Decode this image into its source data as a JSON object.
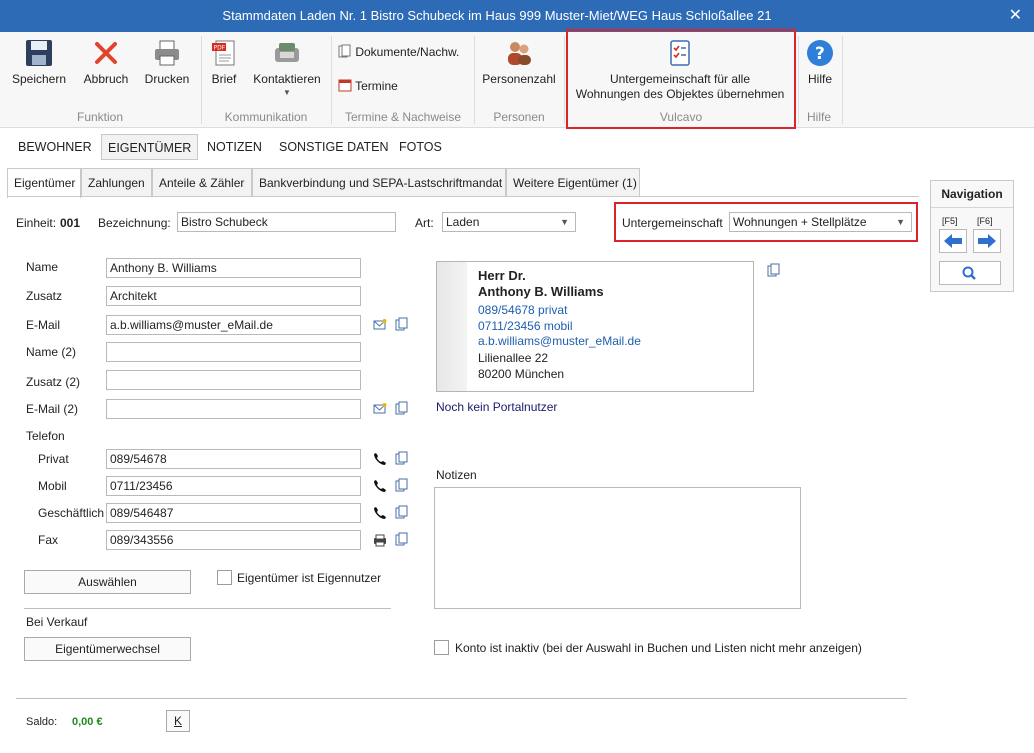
{
  "window": {
    "title": "Stammdaten Laden Nr. 1 Bistro Schubeck im Haus 999  Muster-Miet/WEG Haus Schloßallee 21",
    "close_glyph": "✕"
  },
  "ribbon": {
    "groups": {
      "funktion": "Funktion",
      "kommunikation": "Kommunikation",
      "termine": "Termine & Nachweise",
      "personen": "Personen",
      "vulcavo": "Vulcavo",
      "hilfe": "Hilfe"
    },
    "buttons": {
      "speichern": "Speichern",
      "abbruch": "Abbruch",
      "drucken": "Drucken",
      "brief": "Brief",
      "kontaktieren": "Kontaktieren",
      "dokumente": "Dokumente/Nachw.",
      "termine": "Termine",
      "personenzahl": "Personenzahl",
      "untergemeinschaft_line1": "Untergemeinschaft für alle",
      "untergemeinschaft_line2": "Wohnungen des Objektes übernehmen",
      "hilfe": "Hilfe"
    },
    "icons": {
      "save": "save-icon",
      "cancel": "cancel-icon",
      "print": "printer-icon",
      "pdf": "pdf-letter-icon",
      "contact": "fax-phone-icon",
      "docs": "documents-icon",
      "calendar": "calendar-icon",
      "people": "people-icon",
      "checklist": "checklist-icon",
      "help": "help-icon"
    },
    "accent_color": "#2e6bb7",
    "highlight_color": "#d9252a"
  },
  "section_tabs": [
    "BEWOHNER",
    "EIGENTÜMER",
    "NOTIZEN",
    "SONSTIGE DATEN",
    "FOTOS"
  ],
  "sub_tabs": [
    "Eigentümer",
    "Zahlungen",
    "Anteile & Zähler",
    "Bankverbindung und SEPA-Lastschriftmandat",
    "Weitere Eigentümer (1)"
  ],
  "header_row": {
    "einheit_label": "Einheit:",
    "einheit_value": "001",
    "bezeichnung_label": "Bezeichnung:",
    "bezeichnung_value": "Bistro Schubeck",
    "art_label": "Art:",
    "art_value": "Laden",
    "untergemeinschaft_label": "Untergemeinschaft",
    "untergemeinschaft_value": "Wohnungen + Stellplätze"
  },
  "form": {
    "name_label": "Name",
    "name_value": "Anthony B. Williams",
    "zusatz_label": "Zusatz",
    "zusatz_value": "Architekt",
    "email_label": "E-Mail",
    "email_value": "a.b.williams@muster_eMail.de",
    "name2_label": "Name (2)",
    "name2_value": "",
    "zusatz2_label": "Zusatz (2)",
    "zusatz2_value": "",
    "email2_label": "E-Mail (2)",
    "email2_value": "",
    "telefon_label": "Telefon",
    "privat_label": "Privat",
    "privat_value": "089/54678",
    "mobil_label": "Mobil",
    "mobil_value": "0711/23456",
    "geschaeftlich_label": "Geschäftlich",
    "geschaeftlich_value": "089/546487",
    "fax_label": "Fax",
    "fax_value": "089/343556",
    "auswaehlen_button": "Auswählen",
    "eigennutzer_label": "Eigentümer ist Eigennutzer",
    "bei_verkauf_label": "Bei Verkauf",
    "eigentuemerwechsel_button": "Eigentümerwechsel"
  },
  "card": {
    "line1": "Herr Dr.",
    "line2": "Anthony B. Williams",
    "phone_privat": "089/54678 privat",
    "phone_mobil": "0711/23456 mobil",
    "email": "a.b.williams@muster_eMail.de",
    "street": "Lilienallee 22",
    "city": "80200 München",
    "link_color": "#1f5fb0"
  },
  "portal_status": "Noch kein Portalnutzer",
  "notizen_label": "Notizen",
  "konto_inaktiv_label": "Konto ist inaktiv (bei der Auswahl in Buchen und Listen nicht mehr anzeigen)",
  "saldo": {
    "label": "Saldo:",
    "value": "0,00 €",
    "k_button": "K",
    "value_color": "#1d8a1d"
  },
  "navigation": {
    "title": "Navigation",
    "f5": "[F5]",
    "f6": "[F6]"
  }
}
